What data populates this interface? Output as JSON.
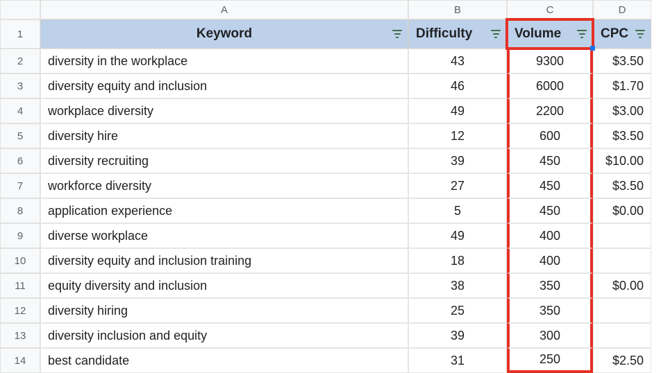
{
  "columns": [
    "A",
    "B",
    "C",
    "D"
  ],
  "headers": {
    "keyword": "Keyword",
    "difficulty": "Difficulty",
    "volume": "Volume",
    "cpc": "CPC"
  },
  "rows": [
    {
      "n": "1"
    },
    {
      "n": "2",
      "keyword": "diversity in the workplace",
      "difficulty": "43",
      "volume": "9300",
      "cpc": "$3.50"
    },
    {
      "n": "3",
      "keyword": "diversity equity and inclusion",
      "difficulty": "46",
      "volume": "6000",
      "cpc": "$1.70"
    },
    {
      "n": "4",
      "keyword": "workplace diversity",
      "difficulty": "49",
      "volume": "2200",
      "cpc": "$3.00"
    },
    {
      "n": "5",
      "keyword": "diversity hire",
      "difficulty": "12",
      "volume": "600",
      "cpc": "$3.50"
    },
    {
      "n": "6",
      "keyword": "diversity recruiting",
      "difficulty": "39",
      "volume": "450",
      "cpc": "$10.00"
    },
    {
      "n": "7",
      "keyword": "workforce diversity",
      "difficulty": "27",
      "volume": "450",
      "cpc": "$3.50"
    },
    {
      "n": "8",
      "keyword": "application experience",
      "difficulty": "5",
      "volume": "450",
      "cpc": "$0.00"
    },
    {
      "n": "9",
      "keyword": "diverse workplace",
      "difficulty": "49",
      "volume": "400",
      "cpc": ""
    },
    {
      "n": "10",
      "keyword": "diversity equity and inclusion training",
      "difficulty": "18",
      "volume": "400",
      "cpc": ""
    },
    {
      "n": "11",
      "keyword": "equity diversity and inclusion",
      "difficulty": "38",
      "volume": "350",
      "cpc": "$0.00"
    },
    {
      "n": "12",
      "keyword": "diversity hiring",
      "difficulty": "25",
      "volume": "350",
      "cpc": ""
    },
    {
      "n": "13",
      "keyword": "diversity inclusion and equity",
      "difficulty": "39",
      "volume": "300",
      "cpc": ""
    },
    {
      "n": "14",
      "keyword": "best candidate",
      "difficulty": "31",
      "volume": "250",
      "cpc": "$2.50"
    }
  ],
  "chart_data": {
    "type": "table",
    "title": "Keyword research spreadsheet",
    "columns": [
      "Keyword",
      "Difficulty",
      "Volume",
      "CPC"
    ],
    "highlighted_column": "Volume",
    "data": [
      [
        "diversity in the workplace",
        43,
        9300,
        3.5
      ],
      [
        "diversity equity and inclusion",
        46,
        6000,
        1.7
      ],
      [
        "workplace diversity",
        49,
        2200,
        3.0
      ],
      [
        "diversity hire",
        12,
        600,
        3.5
      ],
      [
        "diversity recruiting",
        39,
        450,
        10.0
      ],
      [
        "workforce diversity",
        27,
        450,
        3.5
      ],
      [
        "application experience",
        5,
        450,
        0.0
      ],
      [
        "diverse workplace",
        49,
        400,
        null
      ],
      [
        "diversity equity and inclusion training",
        18,
        400,
        null
      ],
      [
        "equity diversity and inclusion",
        38,
        350,
        0.0
      ],
      [
        "diversity hiring",
        25,
        350,
        null
      ],
      [
        "diversity inclusion and equity",
        39,
        300,
        null
      ],
      [
        "best candidate",
        31,
        250,
        2.5
      ]
    ]
  }
}
